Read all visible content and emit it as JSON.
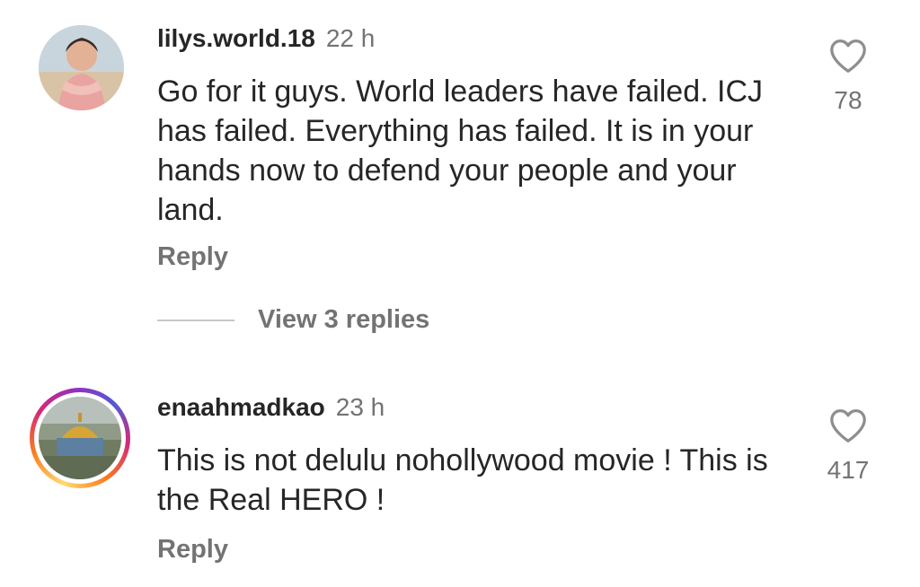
{
  "comments": [
    {
      "username": "lilys.world.18",
      "time": "22 h",
      "text": "Go for it guys. World leaders have failed. ICJ has failed. Everything has failed. It is in your hands now to defend your people and your land.",
      "reply_label": "Reply",
      "likes": "78",
      "avatar_story_ring": false
    },
    {
      "username": "enaahmadkao",
      "time": "23 h",
      "text": "This is not delulu nohollywood movie ! This is the Real HERO !",
      "reply_label": "Reply",
      "likes": "417",
      "avatar_story_ring": true
    }
  ],
  "view_replies": "View 3 replies",
  "icons": {
    "like": "heart-outline-icon"
  },
  "colors": {
    "username": "#262626",
    "secondary": "#737373",
    "divider": "#c7c7c7"
  }
}
